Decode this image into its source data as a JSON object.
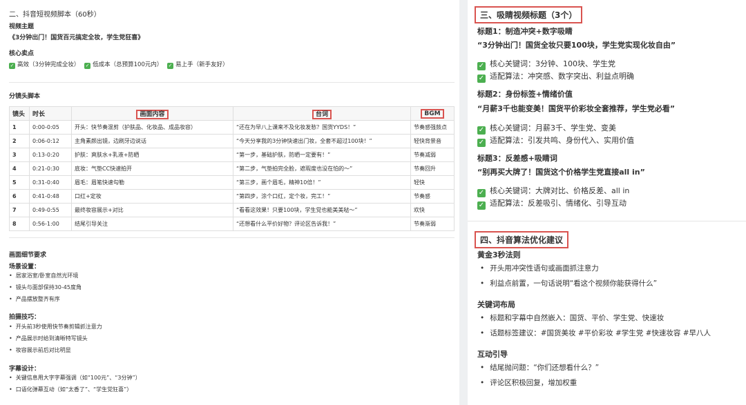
{
  "left": {
    "section_title": "二、抖音短视频脚本（60秒）",
    "theme_label": "视频主题",
    "theme_value": "《3分钟出门！国货百元搞定全妆，学生党狂喜》",
    "selling_label": "核心卖点",
    "selling_points": [
      "高效（3分钟完成全妆）",
      "低成本（总预算100元内）",
      "易上手（新手友好）"
    ],
    "storyboard_label": "分镜头脚本",
    "table": {
      "headers": [
        "镜头",
        "时长",
        "画面内容",
        "台词",
        "BGM"
      ],
      "rows": [
        [
          "1",
          "0:00-0:05",
          "开头：快节奏混剪（护肤品、化妆品、成品妆容）",
          "“还在为早八上课来不及化妆发愁？国货YYDS！”",
          "节奏感强鼓点"
        ],
        [
          "2",
          "0:06-0:12",
          "主角素颜出镜，边刷牙边说话",
          "“今天分享我的3分钟快速出门妆，全套不超过100块！”",
          "轻快背景音"
        ],
        [
          "3",
          "0:13-0:20",
          "护肤：爽肤水+乳液+防晒",
          "“第一步，基础护肤，防晒一定要有！”",
          "节奏减弱"
        ],
        [
          "4",
          "0:21-0:30",
          "底妆：气垫CC快速拍开",
          "“第二步，气垫拍完全脸，遮瑕度也没在怕的～”",
          "节奏回升"
        ],
        [
          "5",
          "0:31-0:40",
          "眉毛：眉笔快速勾勒",
          "“第三步，画个眉毛，精神10倍！”",
          "轻快"
        ],
        [
          "6",
          "0:41-0:48",
          "口红+定妆",
          "“第四步，涂个口红，定个妆，完工！”",
          "节奏感"
        ],
        [
          "7",
          "0:49-0:55",
          "最终妆容展示+对比",
          "“看看这效果！只要100块，学生党也能美美哒～”",
          "欢快"
        ],
        [
          "8",
          "0:56-1:00",
          "结尾引导关注",
          "“还想看什么平价好物？评论区告诉我！”",
          "节奏渐弱"
        ]
      ]
    },
    "detail_title": "画面细节要求",
    "scene_label": "场景设置：",
    "scene_items": [
      "居家浴室/卧室自然光环境",
      "镜头与面部保持30-45度角",
      "产品摆放整齐有序"
    ],
    "shoot_label": "拍摄技巧：",
    "shoot_items": [
      "开头前3秒使用快节奏剪辑抓注意力",
      "产品展示时给到清晰特写镜头",
      "妆容展示前后对比明显"
    ],
    "subtitle_label": "字幕设计：",
    "subtitle_items": [
      "关键信息用大字字幕强调（如“100元”、“3分钟”）",
      "口语化弹幕互动（如“太香了”、“学生党狂喜”）"
    ]
  },
  "right": {
    "section3": "三、吸睛视频标题（3个）",
    "titles": [
      {
        "label": "标题1：制造冲突+数字吸睛",
        "quote": "“3分钟出门！国货全妆只要100块，学生党实现化妆自由”",
        "keywords": "核心关键词：3分钟、100块、学生党",
        "algo": "适配算法：冲突感、数字突出、利益点明确"
      },
      {
        "label": "标题2：身份标签+情绪价值",
        "quote": "“月薪3千也能变美！国货平价彩妆全套推荐，学生党必看”",
        "keywords": "核心关键词：月薪3千、学生党、变美",
        "algo": "适配算法：引发共鸣、身份代入、实用价值"
      },
      {
        "label": "标题3：反差感+吸睛词",
        "quote": "“别再买大牌了！国货这个价格学生党直接all in”",
        "keywords": "核心关键词：大牌对比、价格反差、all in",
        "algo": "适配算法：反差吸引、情绪化、引导互动"
      }
    ],
    "section4": "四、抖音算法优化建议",
    "golden_label": "黄金3秒法则",
    "golden_items": [
      "开头用冲突性语句或画面抓注意力",
      "利益点前置，一句话说明“看这个视频你能获得什么”"
    ],
    "keyword_label": "关键词布局",
    "keyword_items": [
      "标题和字幕中自然嵌入：国货、平价、学生党、快速妆",
      "话题标签建议：#国货美妆 #平价彩妆 #学生党 #快速妆容 #早八人"
    ],
    "interact_label": "互动引导",
    "interact_items": [
      "结尾抛问题：“你们还想看什么？”",
      "评论区积极回复，增加权重"
    ]
  }
}
